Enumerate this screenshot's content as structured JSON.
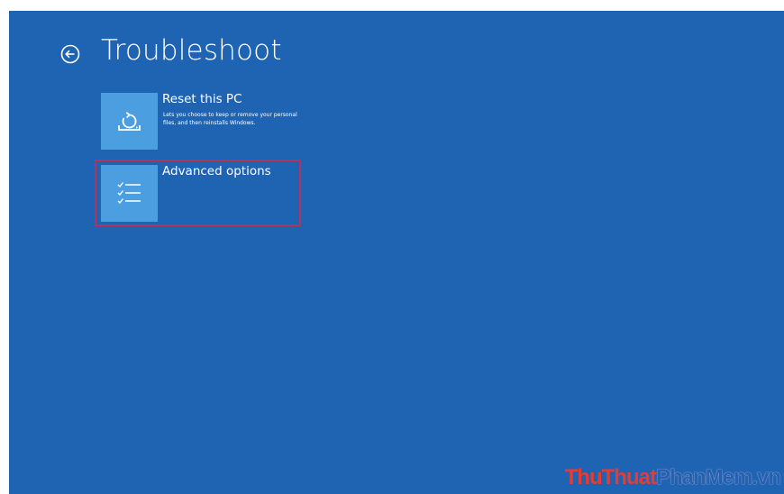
{
  "header": {
    "back_icon": "back-arrow-circle-icon",
    "title": "Troubleshoot"
  },
  "options": [
    {
      "title": "Reset this PC",
      "description": "Lets you choose to keep or remove your personal files, and then reinstalls Windows.",
      "icon": "reset-pc-icon"
    },
    {
      "title": "Advanced options",
      "description": "",
      "icon": "checklist-icon"
    }
  ],
  "highlight": {
    "target": "Advanced options",
    "color": "#b0345c"
  },
  "watermark": {
    "part1": "ThuThuat",
    "part2": "PhanMem",
    "part3": ".vn"
  },
  "colors": {
    "background": "#1f64b3",
    "tile": "#4b9fe0",
    "text": "#ffffff"
  }
}
